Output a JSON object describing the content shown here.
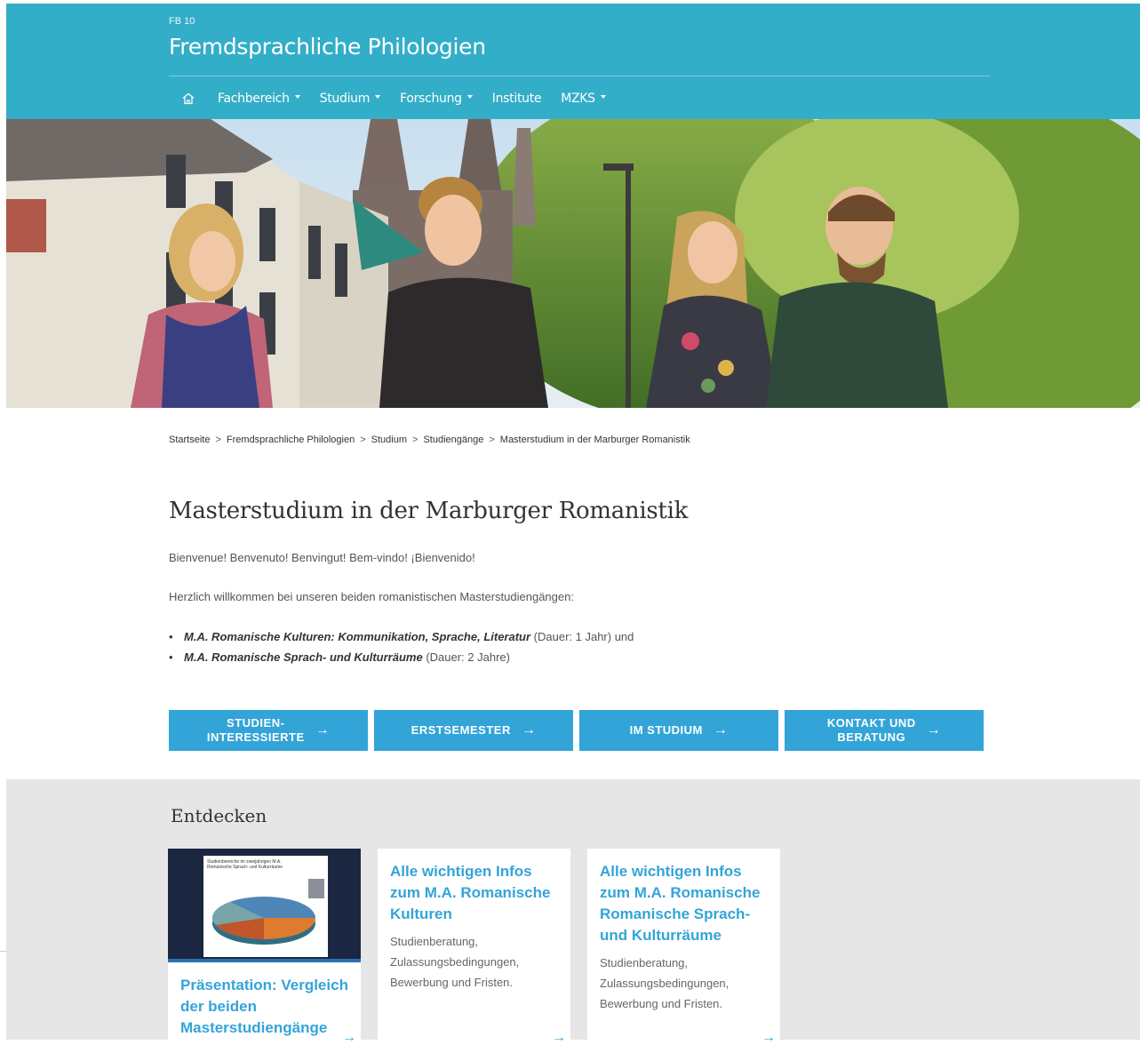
{
  "header": {
    "fb": "FB 10",
    "title": "Fremdsprachliche Philologien",
    "home_icon": "home-icon",
    "nav": [
      {
        "label": "Fachbereich",
        "dropdown": true
      },
      {
        "label": "Studium",
        "dropdown": true
      },
      {
        "label": "Forschung",
        "dropdown": true
      },
      {
        "label": "Institute",
        "dropdown": false
      },
      {
        "label": "MZKS",
        "dropdown": true
      }
    ]
  },
  "breadcrumb": [
    "Startseite",
    "Fremdsprachliche Philologien",
    "Studium",
    "Studiengänge",
    "Masterstudium in der Marburger Romanistik"
  ],
  "breadcrumb_separator": ">",
  "main": {
    "title": "Masterstudium in der Marburger Romanistik",
    "greeting": "Bienvenue! Benvenuto! Benvingut! Bem-vindo! ¡Bienvenido!",
    "intro": "Herzlich willkommen bei unseren beiden romanistischen Masterstudiengängen:",
    "list": [
      {
        "bold": "M.A. Romanische Kulturen: Kommunikation, Sprache, Literatur",
        "rest": " (Dauer: 1 Jahr) und"
      },
      {
        "bold": "M.A. Romanische Sprach- und Kulturräume",
        "rest": " (Dauer: 2 Jahre)"
      }
    ]
  },
  "buttons": [
    {
      "line1": "STUDIEN-",
      "line2": "INTERESSIERTE"
    },
    {
      "line1": "ERSTSEMESTER",
      "line2": ""
    },
    {
      "line1": "IM STUDIUM",
      "line2": ""
    },
    {
      "line1": "KONTAKT UND",
      "line2": "BERATUNG"
    }
  ],
  "arrow_glyph": "→",
  "discover": {
    "title": "Entdecken",
    "cards": [
      {
        "title": "Präsentation: Vergleich der beiden Masterstudiengänge",
        "text": "",
        "thumb_caption": "Studienbereiche im zweijährigen M.A. Romanische Sprach- und Kulturräume"
      },
      {
        "title": "Alle wichtigen Infos zum M.A. Romanische Kulturen",
        "text": "Studienberatung, Zulassungsbedingungen, Bewerbung und Fristen."
      },
      {
        "title": "Alle wichtigen Infos zum M.A. Romanische Romanische Sprach- und Kulturräume",
        "text": "Studienberatung, Zulassungsbedingungen, Bewerbung und Fristen."
      }
    ]
  },
  "colors": {
    "header": "#33aec8",
    "button": "#33a4d8",
    "link": "#33a4d8",
    "discover_bg": "#e6e6e6"
  }
}
